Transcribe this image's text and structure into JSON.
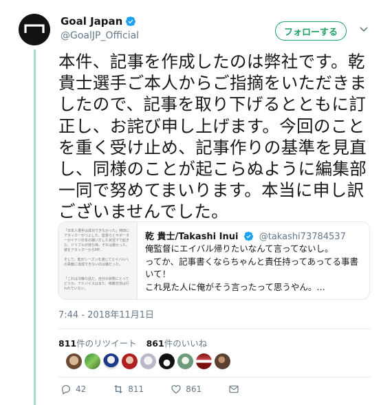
{
  "account": {
    "name": "Goal Japan",
    "handle": "@GoalJP_Official",
    "follow_label": "フォローする"
  },
  "tweet": {
    "text": "本件、記事を作成したのは弊社です。乾貴士選手ご本人からご指摘をいただきましたので、記事を取り下げるとともに訂正し、お詫び申し上げます。今回のことを重く受け止め、記事作りの基準を見直し、同様のことが起こらぬように編集部一同で努めてまいります。本当に申し訳ございませんでした。",
    "timestamp": "7:44 - 2018年11月1日"
  },
  "quote": {
    "author": "乾 貴士/Takashi Inui",
    "handle": "@takashi73784537",
    "lines": [
      "俺監督にエイバル帰りたいなんて言ってないし。",
      "ってか、記事書くならちゃんと責任持ってあってる事書いて！",
      "これ見た人に俺がそう言ったって思うやん。…"
    ],
    "image_text": [
      "「日本人選手は成功できなかった」柿田にアタッカーがつぶした、監督らとサポーターがイテリ日本の戦い方した状況下で起きた、ドリブルが持ち味。それは悪かった。彼をアタッカーからMF...",
      "そして、乾がシーズンを通じてエイバルへの貢献に達成できないのは嫌だった。",
      "「これは冷静な話だ。自分の状態にとってどうか。アドバイスはまた、移籍交渉は行われていない。"
    ]
  },
  "stats": {
    "retweets_count": "811",
    "retweets_label": "件のリツイート",
    "likes_count": "861",
    "likes_label": "件のいいね"
  },
  "actions": {
    "replies": "42",
    "retweets": "811",
    "likes": "861"
  },
  "colors": {
    "accent": "#17a062",
    "verified": "#1da1f2",
    "muted": "#657786"
  }
}
